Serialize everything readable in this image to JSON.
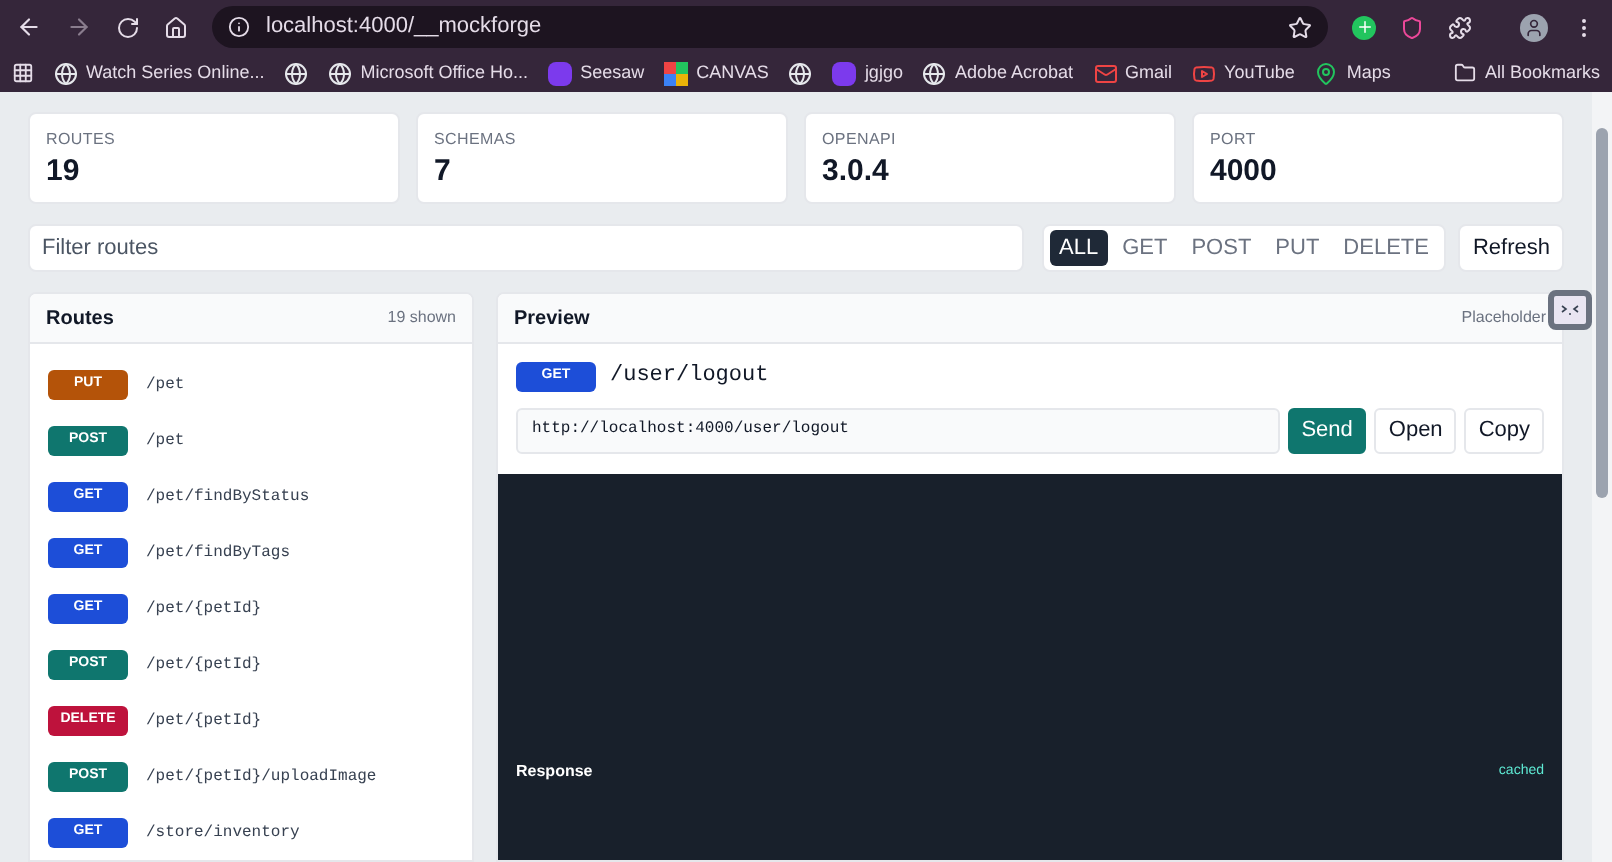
{
  "browser": {
    "url": "localhost:4000/__mockforge",
    "bookmarks": [
      {
        "kind": "globe",
        "label": "Watch Series Online..."
      },
      {
        "kind": "globe"
      },
      {
        "kind": "globe",
        "label": "Microsoft Office Ho..."
      },
      {
        "kind": "letter",
        "label": "Seesaw"
      },
      {
        "kind": "grid",
        "label": "CANVAS"
      },
      {
        "kind": "globe"
      },
      {
        "kind": "letter",
        "label": "jgjgo"
      },
      {
        "kind": "globe",
        "label": "Adobe Acrobat"
      },
      {
        "kind": "mail",
        "label": "Gmail"
      },
      {
        "kind": "video",
        "label": "YouTube"
      },
      {
        "kind": "pin",
        "label": "Maps"
      }
    ],
    "all_bookmarks": "All Bookmarks"
  },
  "stats": [
    {
      "label": "ROUTES",
      "value": "19"
    },
    {
      "label": "SCHEMAS",
      "value": "7"
    },
    {
      "label": "OPENAPI",
      "value": "3.0.4"
    },
    {
      "label": "PORT",
      "value": "4000"
    }
  ],
  "filter": {
    "placeholder": "Filter routes",
    "methods": [
      {
        "label": "ALL",
        "selected": true
      },
      {
        "label": "GET",
        "selected": false
      },
      {
        "label": "POST",
        "selected": false
      },
      {
        "label": "PUT",
        "selected": false
      },
      {
        "label": "DELETE",
        "selected": false
      }
    ],
    "refresh": "Refresh"
  },
  "routes": {
    "title": "Routes",
    "count": "19 shown",
    "items": [
      {
        "method": "PUT",
        "color": "#b45309",
        "path": "/pet"
      },
      {
        "method": "POST",
        "color": "#0f766e",
        "path": "/pet"
      },
      {
        "method": "GET",
        "color": "#1d4ed8",
        "path": "/pet/findByStatus"
      },
      {
        "method": "GET",
        "color": "#1d4ed8",
        "path": "/pet/findByTags"
      },
      {
        "method": "GET",
        "color": "#1d4ed8",
        "path": "/pet/{petId}"
      },
      {
        "method": "POST",
        "color": "#0f766e",
        "path": "/pet/{petId}"
      },
      {
        "method": "DELETE",
        "color": "#be123c",
        "path": "/pet/{petId}"
      },
      {
        "method": "POST",
        "color": "#0f766e",
        "path": "/pet/{petId}/uploadImage"
      },
      {
        "method": "GET",
        "color": "#1d4ed8",
        "path": "/store/inventory"
      }
    ]
  },
  "preview": {
    "title": "Preview",
    "note": "Placeholder",
    "method": {
      "label": "GET",
      "color": "#1d4ed8"
    },
    "path": "/user/logout",
    "url": "http://localhost:4000/user/logout",
    "buttons": [
      {
        "kind": "primary",
        "label": "Send"
      },
      {
        "kind": "plain",
        "label": "Open"
      },
      {
        "kind": "plain",
        "label": "Copy"
      }
    ],
    "response_title": "Response",
    "response_status": "cached"
  }
}
